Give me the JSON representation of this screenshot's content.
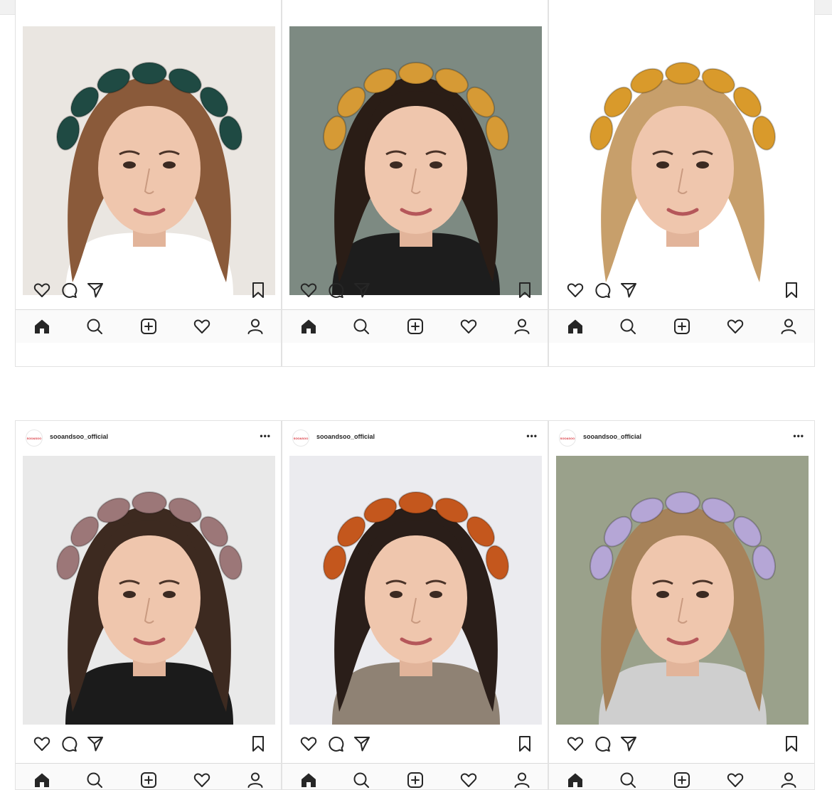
{
  "screen": {
    "accent_color": "#e6532b",
    "icon_color": "#262626"
  },
  "posts": [
    {
      "row": 1,
      "username": "",
      "avatar_text": "",
      "headband_color": "#1f4a43",
      "hair_color": "#8a5a3a",
      "background_color": "#eae6e1",
      "top_color": "#ffffff"
    },
    {
      "row": 1,
      "username": "",
      "avatar_text": "",
      "headband_color": "#d69a35",
      "hair_color": "#2a1d16",
      "background_color": "#7d8a82",
      "top_color": "#1d1d1d"
    },
    {
      "row": 1,
      "username": "",
      "avatar_text": "",
      "headband_color": "#d99a2b",
      "hair_color": "#c79f6b",
      "background_color": "#ffffff",
      "top_color": "#ffffff"
    },
    {
      "row": 2,
      "username": "sooandsoo_official",
      "avatar_text": "SOO&SOO",
      "headband_color": "#9c7778",
      "hair_color": "#3d2a20",
      "background_color": "#e9e9e9",
      "top_color": "#1b1b1b"
    },
    {
      "row": 2,
      "username": "sooandsoo_official",
      "avatar_text": "SOO&SOO",
      "headband_color": "#c4571d",
      "hair_color": "#2a1e19",
      "background_color": "#ebebef",
      "top_color": "#8f8274"
    },
    {
      "row": 2,
      "username": "sooandsoo_official",
      "avatar_text": "SOO&SOO",
      "headband_color": "#b5a6d6",
      "hair_color": "#a6825a",
      "background_color": "#9aa18b",
      "top_color": "#cfcfcf"
    }
  ],
  "post_icons": [
    "heart-icon",
    "comment-icon",
    "share-icon",
    "bookmark-icon"
  ],
  "nav_icons": [
    "home-icon",
    "search-icon",
    "add-post-icon",
    "activity-heart-icon",
    "profile-icon"
  ],
  "more_label": "•••"
}
